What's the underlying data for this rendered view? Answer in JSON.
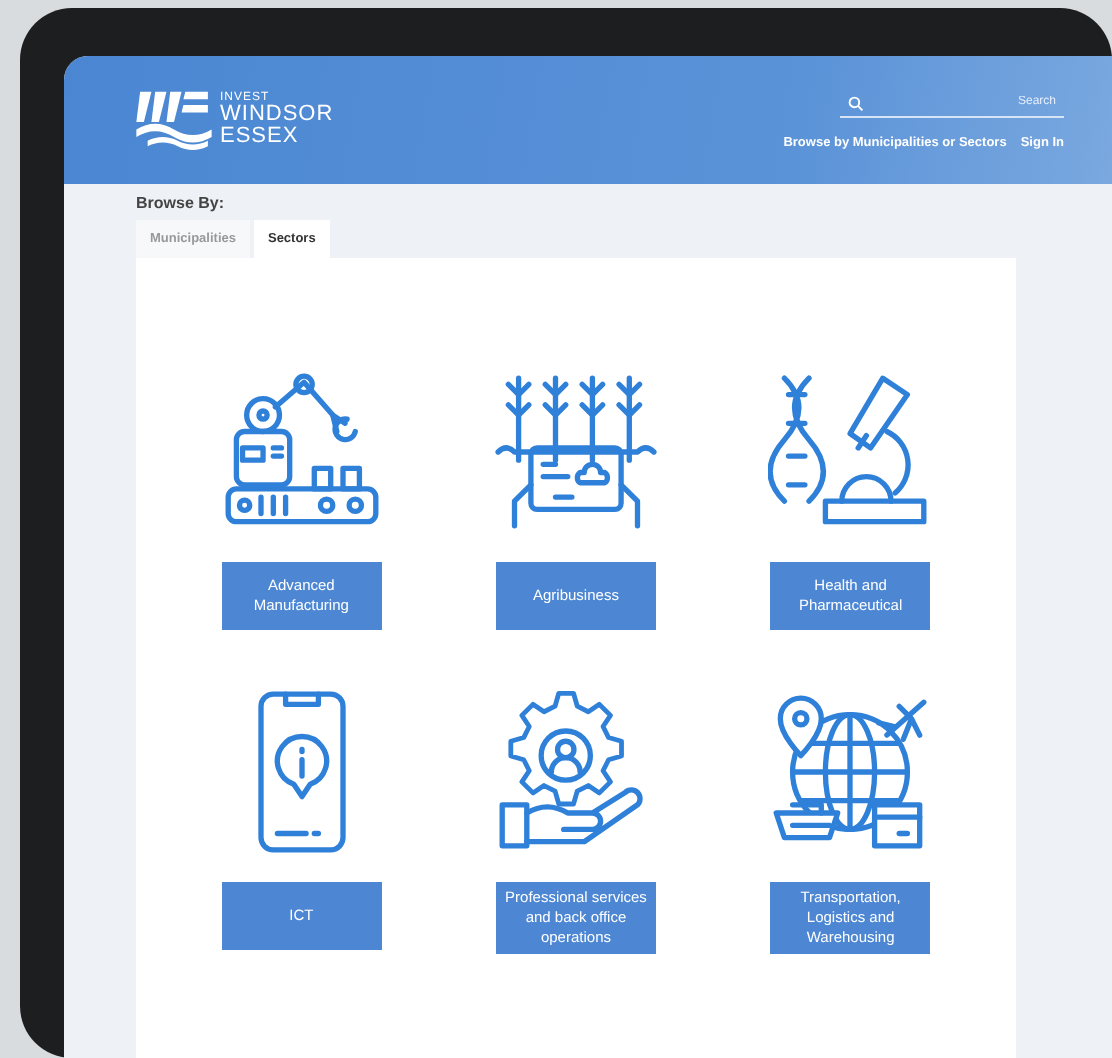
{
  "header": {
    "logo": [
      "INVEST",
      "WINDSOR",
      "ESSEX"
    ],
    "search": {
      "placeholder": "Search"
    },
    "nav": [
      "Browse by Municipalities or Sectors",
      "Sign In"
    ]
  },
  "browse": {
    "heading": "Browse By:",
    "tabs": [
      {
        "label": "Municipalities",
        "selected": false
      },
      {
        "label": "Sectors",
        "selected": true
      }
    ]
  },
  "sectors": [
    {
      "label": "Advanced Manufacturing",
      "kind": "robot"
    },
    {
      "label": "Agribusiness",
      "kind": "crops"
    },
    {
      "label": "Health and Pharmaceutical",
      "kind": "lab"
    },
    {
      "label": "ICT",
      "kind": "phone"
    },
    {
      "label": "Professional services and back office operations",
      "kind": "service"
    },
    {
      "label": "Transportation, Logistics and Warehousing",
      "kind": "globe"
    }
  ]
}
